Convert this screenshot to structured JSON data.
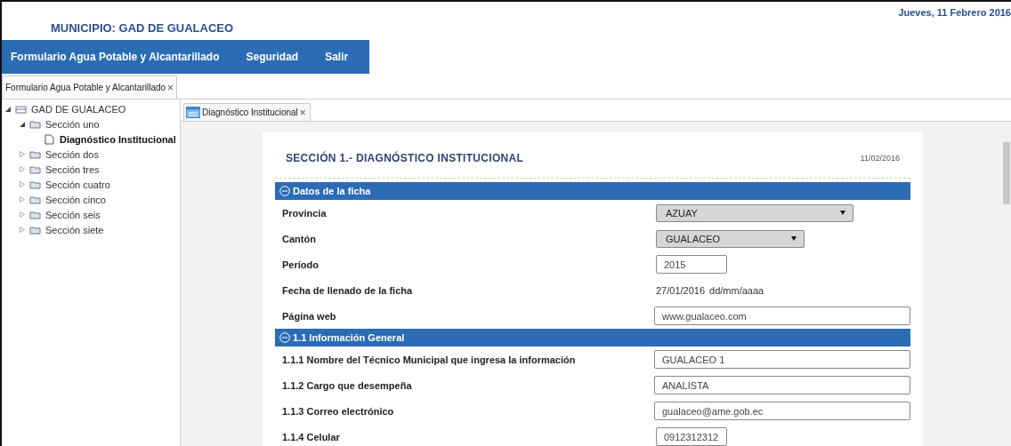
{
  "header": {
    "title": "MUNICIPIO: GAD DE GUALACEO",
    "date": "Jueves, 11 Febrero 2016"
  },
  "nav": [
    {
      "label": "Formulario Agua Potable y Alcantarillado"
    },
    {
      "label": "Seguridad"
    },
    {
      "label": "Salir"
    }
  ],
  "outer_tabs": [
    {
      "label": "Formulario Agua Potable y Alcantarillado",
      "close": "×",
      "selected": true
    }
  ],
  "tree": [
    {
      "label": "GAD DE GUALACEO",
      "kind": "root",
      "expanded": true,
      "selected": false,
      "children": [
        {
          "label": "Sección uno",
          "kind": "folder",
          "expanded": true,
          "selected": false,
          "children": [
            {
              "label": "Diagnóstico Institucional",
              "kind": "file",
              "selected": true
            }
          ]
        },
        {
          "label": "Sección dos",
          "kind": "folder",
          "expanded": false,
          "selected": false
        },
        {
          "label": "Sección tres",
          "kind": "folder",
          "expanded": false,
          "selected": false
        },
        {
          "label": "Sección cuatro",
          "kind": "folder",
          "expanded": false,
          "selected": false
        },
        {
          "label": "Sección cinco",
          "kind": "folder",
          "expanded": false,
          "selected": false
        },
        {
          "label": "Sección seis",
          "kind": "folder",
          "expanded": false,
          "selected": false
        },
        {
          "label": "Sección siete",
          "kind": "folder",
          "expanded": false,
          "selected": false
        }
      ]
    }
  ],
  "inner_tabs": [
    {
      "label": "Diagnóstico Institucional",
      "close": "×",
      "selected": true
    }
  ],
  "form": {
    "title": "SECCIÓN 1.- DIAGNÓSTICO INSTITUCIONAL",
    "date": "11/02/2016",
    "rows": [
      {
        "kind": "header",
        "label": "Datos de la ficha"
      },
      {
        "kind": "wideselect",
        "label": "Provincia",
        "value": "AZUAY"
      },
      {
        "kind": "select",
        "label": "Cantón",
        "value": "GUALACEO"
      },
      {
        "kind": "shortinput",
        "label": "Período",
        "value": "2015"
      },
      {
        "kind": "text",
        "label": "Fecha de llenado de la ficha",
        "value": "27/01/2016",
        "hint": "dd/mm/aaaa"
      },
      {
        "kind": "input",
        "label": "Página web",
        "value": "www.gualaceo.com"
      },
      {
        "kind": "header",
        "label": "1.1 Información General"
      },
      {
        "kind": "input",
        "label": "1.1.1 Nombre del Técnico Municipal que ingresa la información",
        "value": "GUALACEO 1"
      },
      {
        "kind": "input",
        "label": "1.1.2 Cargo que desempeña",
        "value": "ANALISTA"
      },
      {
        "kind": "input",
        "label": "1.1.3 Correo electrónico",
        "value": "gualaceo@ame.gob.ec"
      },
      {
        "kind": "shortinput",
        "label": "1.1.4 Celular",
        "value": "0912312312"
      }
    ]
  }
}
